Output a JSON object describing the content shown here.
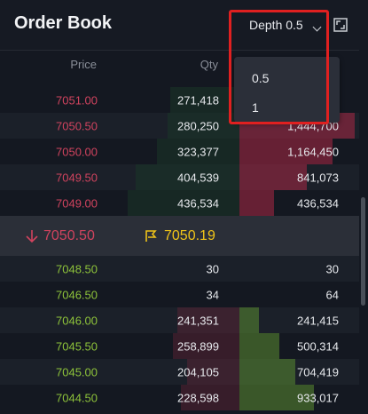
{
  "header": {
    "title": "Order Book",
    "depth_label": "Depth 0.5"
  },
  "dropdown": {
    "options": [
      "0.5",
      "1"
    ],
    "selected": "0.5"
  },
  "columns": {
    "price": "Price",
    "qty": "Qty"
  },
  "asks": [
    {
      "price": "7051.00",
      "qty": "271,418",
      "total": ""
    },
    {
      "price": "7050.50",
      "qty": "280,250",
      "total": "1,444,700"
    },
    {
      "price": "7050.00",
      "qty": "323,377",
      "total": "1,164,450"
    },
    {
      "price": "7049.50",
      "qty": "404,539",
      "total": "841,073"
    },
    {
      "price": "7049.00",
      "qty": "436,534",
      "total": "436,534"
    }
  ],
  "mid": {
    "last_price": "7050.50",
    "mark_price": "7050.19",
    "direction": "down"
  },
  "bids": [
    {
      "price": "7048.50",
      "qty": "30",
      "total": "30"
    },
    {
      "price": "7046.50",
      "qty": "34",
      "total": "64"
    },
    {
      "price": "7046.00",
      "qty": "241,351",
      "total": "241,415"
    },
    {
      "price": "7045.50",
      "qty": "258,899",
      "total": "500,314"
    },
    {
      "price": "7045.00",
      "qty": "204,105",
      "total": "704,419"
    },
    {
      "price": "7044.50",
      "qty": "228,598",
      "total": "933,017"
    }
  ],
  "colors": {
    "ask": "#d0435e",
    "bid": "#8ec33a",
    "mark": "#f0c419",
    "highlight": "#e02020"
  }
}
